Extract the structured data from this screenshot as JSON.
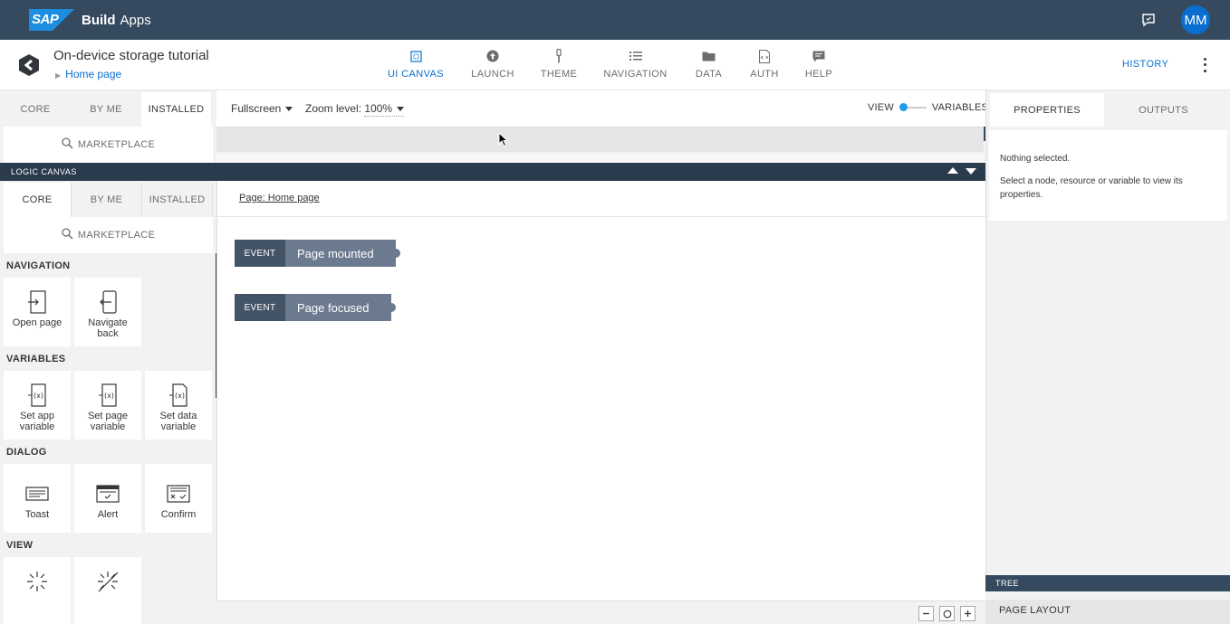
{
  "shell": {
    "brand_logo": "SAP",
    "product": "Build",
    "product_suffix": "Apps",
    "avatar_initials": "MM",
    "feedback_icon": "feedback-icon"
  },
  "app": {
    "title": "On-device storage tutorial",
    "breadcrumb": "Home page"
  },
  "topnav": [
    {
      "label": "UI CANVAS",
      "icon": "ui-canvas-icon",
      "active": true
    },
    {
      "label": "LAUNCH",
      "icon": "launch-icon",
      "active": false
    },
    {
      "label": "THEME",
      "icon": "theme-icon",
      "active": false
    },
    {
      "label": "NAVIGATION",
      "icon": "navigation-icon",
      "active": false
    },
    {
      "label": "DATA",
      "icon": "data-icon",
      "active": false
    },
    {
      "label": "AUTH",
      "icon": "auth-icon",
      "active": false
    },
    {
      "label": "HELP",
      "icon": "help-icon",
      "active": false
    }
  ],
  "history_label": "HISTORY",
  "ui_palette": {
    "tabs": [
      "CORE",
      "BY ME",
      "INSTALLED"
    ],
    "active_tab": "INSTALLED",
    "marketplace": "MARKETPLACE"
  },
  "canvas_toolbar": {
    "view_mode": "Fullscreen",
    "zoom_label": "Zoom level:",
    "zoom_value": "100%",
    "view_label": "VIEW",
    "variables_label": "VARIABLES"
  },
  "properties": {
    "tabs": [
      "PROPERTIES",
      "OUTPUTS"
    ],
    "active_tab": "PROPERTIES",
    "empty_title": "Nothing selected.",
    "empty_hint": "Select a node, resource or variable to view its properties."
  },
  "logic_canvas": {
    "title": "LOGIC CANVAS",
    "page_link": "Page: Home page",
    "events": [
      {
        "tag": "EVENT",
        "name": "Page mounted"
      },
      {
        "tag": "EVENT",
        "name": "Page focused"
      }
    ]
  },
  "logic_palette": {
    "tabs": [
      "CORE",
      "BY ME",
      "INSTALLED"
    ],
    "active_tab": "CORE",
    "marketplace": "MARKETPLACE",
    "sections": [
      {
        "title": "NAVIGATION",
        "items": [
          "Open page",
          "Navigate back"
        ]
      },
      {
        "title": "VARIABLES",
        "items": [
          "Set app variable",
          "Set page variable",
          "Set data variable"
        ]
      },
      {
        "title": "DIALOG",
        "items": [
          "Toast",
          "Alert",
          "Confirm"
        ]
      },
      {
        "title": "VIEW",
        "items": []
      }
    ]
  },
  "tree_label": "TREE",
  "page_layout_label": "PAGE LAYOUT",
  "colors": {
    "shell": "#354a5f",
    "accent": "#0a6ed1",
    "event_tag": "#445467",
    "event_name": "#6b7a8f"
  }
}
